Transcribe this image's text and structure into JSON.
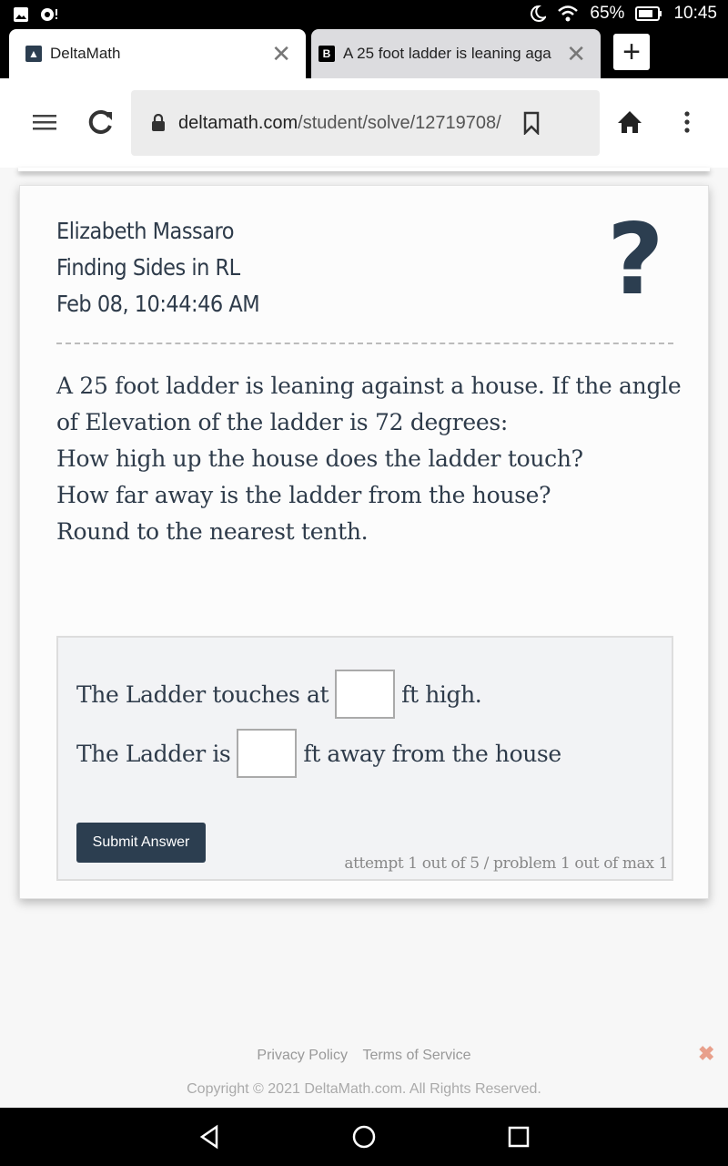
{
  "status_bar": {
    "battery": "65%",
    "time": "10:45",
    "icons": [
      "gallery-icon",
      "notification-icon",
      "moon-icon",
      "wifi-icon",
      "battery-icon"
    ]
  },
  "tabs": [
    {
      "title": "DeltaMath",
      "favicon": "deltamath-icon",
      "active": true
    },
    {
      "title": "A 25 foot ladder is leaning aga",
      "favicon": "brainly-icon",
      "active": false
    }
  ],
  "new_tab_label": "+",
  "toolbar": {
    "url_host": "deltamath.com",
    "url_path": "/student/solve/12719708/"
  },
  "problem": {
    "student_name": "Elizabeth Massaro",
    "assignment": "Finding Sides in RL",
    "timestamp": "Feb 08, 10:44:46 AM",
    "help_symbol": "?",
    "question_lines": [
      "A 25 foot ladder is leaning against a house. If the angle",
      "of Elevation of the ladder is 72 degrees:",
      "How high up the house does the ladder touch?",
      "How far away is the ladder from the house?",
      "Round to the nearest tenth."
    ]
  },
  "answer": {
    "row1_prefix": "The Ladder touches at",
    "row1_suffix": "ft high.",
    "row1_value": "",
    "row2_prefix": "The Ladder is",
    "row2_suffix": "ft away from the house",
    "row2_value": "",
    "submit_label": "Submit Answer",
    "attempt_text": "attempt 1 out of 5 / problem 1 out of max 1"
  },
  "footer": {
    "privacy": "Privacy Policy",
    "terms": "Terms of Service",
    "copyright": "Copyright © 2021 DeltaMath.com. All Rights Reserved.",
    "close_symbol": "✖"
  },
  "colors": {
    "accent": "#2c3e50",
    "text": "#2e3b4a",
    "footer_close": "#e8a08c"
  }
}
